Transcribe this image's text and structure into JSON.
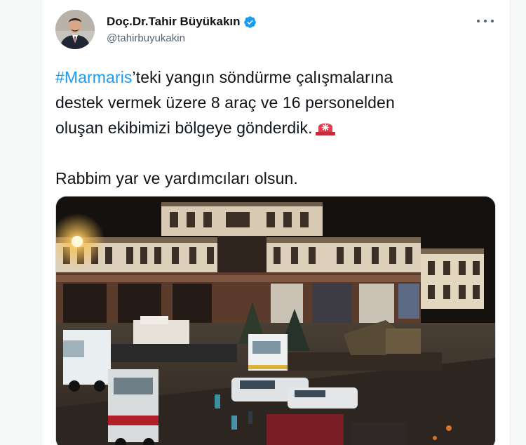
{
  "tweet": {
    "author": {
      "display_name": "Doç.Dr.Tahir Büyükakın",
      "handle": "@tahirbuyukakin",
      "verified": true
    },
    "text": {
      "hashtag": "#Marmaris",
      "line1_rest": "’teki yangın söndürme çalışmalarına",
      "line2": "destek vermek üzere 8 araç ve 16 personelden",
      "line3": "oluşan ekibimizi bölgeye gönderdik.",
      "line4": "Rabbim yar ve yardımcıları olsun."
    },
    "icons": {
      "emoji": "rotating-light-icon",
      "verified": "verified-badge-icon",
      "more": "more-options-icon"
    }
  },
  "colors": {
    "accent": "#1d9bf0",
    "text_primary": "#0f1419",
    "text_secondary": "#536471"
  }
}
